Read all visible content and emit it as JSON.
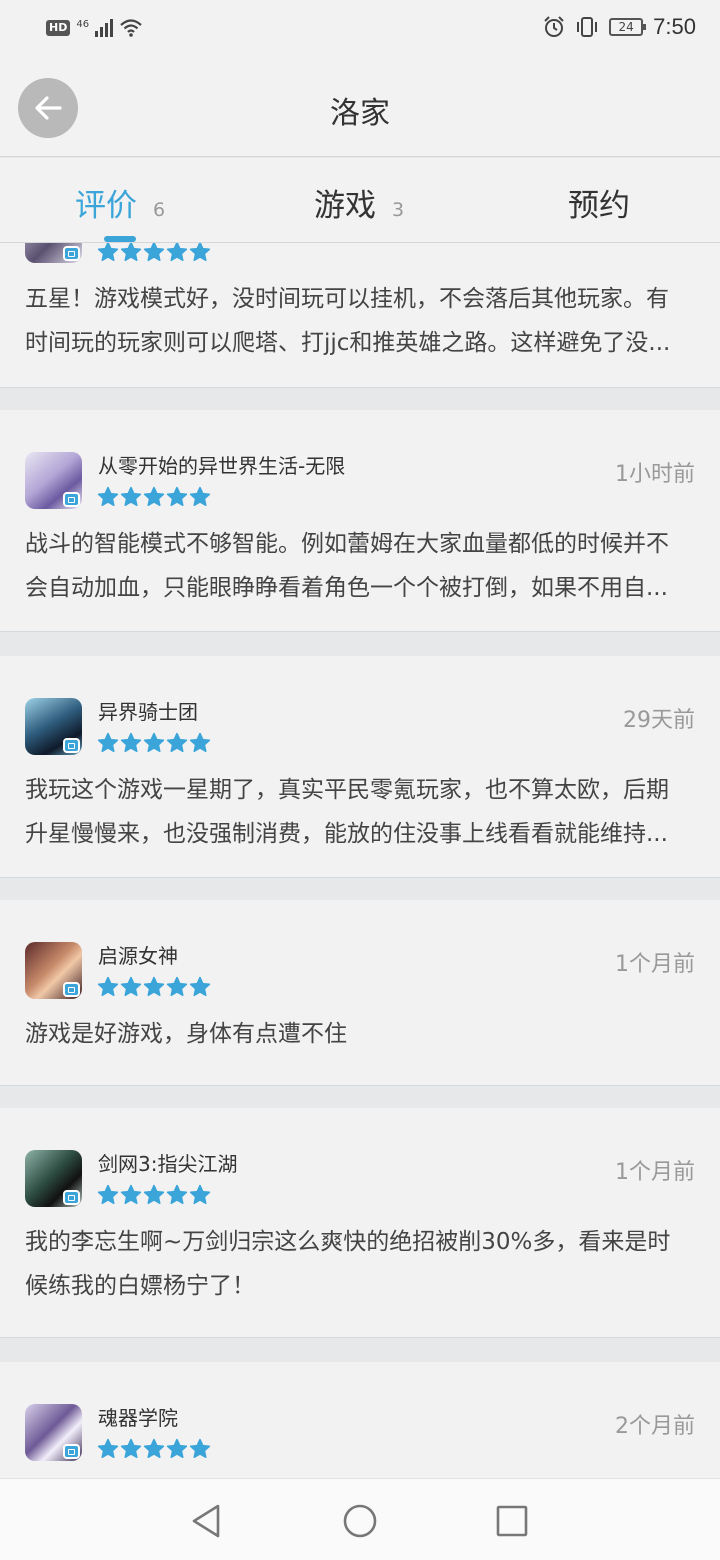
{
  "status_bar": {
    "hd_label": "HD",
    "network_label": "46",
    "battery_level": "24",
    "time": "7:50"
  },
  "header": {
    "title": "洛家",
    "back_icon": "arrow-left-icon"
  },
  "tabs": [
    {
      "label": "评价",
      "count": "6",
      "active": true
    },
    {
      "label": "游戏",
      "count": "3",
      "active": false
    },
    {
      "label": "预约",
      "count": "",
      "active": false
    }
  ],
  "accent_color": "#3ba5da",
  "reviews": [
    {
      "game": "",
      "time": "",
      "rating": 5,
      "text_lines": [
        "五星！游戏模式好，没时间玩可以挂机，不会落后其他玩家。有",
        "时间玩的玩家则可以爬塔、打jjc和推英雄之路。这样避免了没..."
      ]
    },
    {
      "game": "从零开始的异世界生活-无限",
      "time": "1小时前",
      "rating": 5,
      "text_lines": [
        "战斗的智能模式不够智能。例如蕾姆在大家血量都低的时候并不",
        "会自动加血，只能眼睁睁看着角色一个个被打倒，如果不用自..."
      ]
    },
    {
      "game": "异界骑士团",
      "time": "29天前",
      "rating": 5,
      "text_lines": [
        "我玩这个游戏一星期了，真实平民零氪玩家，也不算太欧，后期",
        "升星慢慢来，也没强制消费，能放的住没事上线看看就能维持..."
      ]
    },
    {
      "game": "启源女神",
      "time": "1个月前",
      "rating": 5,
      "text_lines": [
        "游戏是好游戏，身体有点遭不住"
      ]
    },
    {
      "game": "剑网3:指尖江湖",
      "time": "1个月前",
      "rating": 5,
      "text_lines": [
        "我的李忘生啊~万剑归宗这么爽快的绝招被削30%多，看来是时",
        "候练我的白嫖杨宁了！"
      ]
    },
    {
      "game": "魂器学院",
      "time": "2个月前",
      "rating": 5,
      "text_lines": []
    }
  ],
  "nav_bar": {
    "back_icon": "triangle-back-icon",
    "home_icon": "circle-home-icon",
    "recents_icon": "square-recents-icon"
  }
}
